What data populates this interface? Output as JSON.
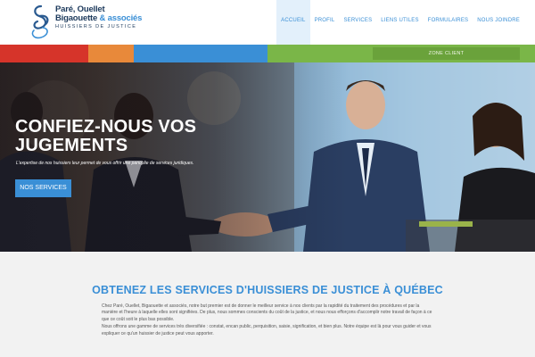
{
  "logo": {
    "line1": "Paré, Ouellet",
    "line2_main": "Bigaouette",
    "line2_amp": "& associés",
    "tagline": "HUISSIERS DE JUSTICE"
  },
  "nav": {
    "items": [
      {
        "label": "ACCUEIL"
      },
      {
        "label": "PROFIL"
      },
      {
        "label": "SERVICES"
      },
      {
        "label": "LIENS UTILES"
      },
      {
        "label": "FORMULAIRES"
      },
      {
        "label": "NOUS JOINDRE"
      }
    ]
  },
  "colors": {
    "accent": "#3a8fd6",
    "stripe": [
      "#d6342a",
      "#e8893a",
      "#3a8fd6",
      "#7ab648"
    ],
    "zone_client": "#6aa23b"
  },
  "zone_client": {
    "label": "ZONE CLIENT"
  },
  "hero": {
    "title": "CONFIEZ-NOUS VOS JUGEMENTS",
    "subtitle": "L'expertise de nos huissiers leur permet de vous offrir une panoplie de services juridiques.",
    "button": "NOS SERVICES"
  },
  "content": {
    "title": "OBTENEZ LES SERVICES D'HUISSIERS DE JUSTICE À QUÉBEC",
    "paragraph1": "Chez Paré, Ouellet, Bigaouette et associés, notre but premier est de donner le meilleur service à nos clients par la rapidité du traitement des procédures et par la manière et l'heure à laquelle elles sont signifiées. De plus, nous sommes conscients du coût de la justice, et nous nous efforçons d'accomplir notre travail de façon à ce que ce coût soit le plus bas possible.",
    "paragraph2": "Nous offrons une gamme de services très diversifiée : constat, encan public, perquisition, saisie, signification, et bien plus. Notre équipe est là pour vous guider et vous expliquer ce qu'un huissier de justice peut vous apporter."
  }
}
